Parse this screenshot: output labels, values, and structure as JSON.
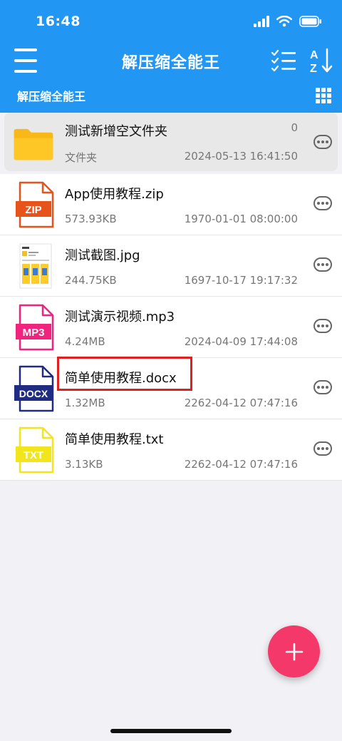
{
  "status_bar": {
    "time": "16:48"
  },
  "header": {
    "title": "解压缩全能王",
    "breadcrumb": "解压缩全能王"
  },
  "files": [
    {
      "name": "测试新增空文件夹",
      "meta": "文件夹",
      "date": "2024-05-13 16:41:50",
      "count": "0",
      "type": "folder"
    },
    {
      "name": "App使用教程.zip",
      "meta": "573.93KB",
      "date": "1970-01-01 08:00:00",
      "type": "zip",
      "badge": "ZIP",
      "color": "#e8531c"
    },
    {
      "name": "测试截图.jpg",
      "meta": "244.75KB",
      "date": "1697-10-17 19:17:32",
      "type": "image"
    },
    {
      "name": "测试演示视频.mp3",
      "meta": "4.24MB",
      "date": "2024-04-09 17:44:08",
      "type": "mp3",
      "badge": "MP3",
      "color": "#f0247e"
    },
    {
      "name": "简单使用教程.docx",
      "meta": "1.32MB",
      "date": "2262-04-12 07:47:16",
      "type": "docx",
      "badge": "DOCX",
      "color": "#1f2c82"
    },
    {
      "name": "简单使用教程.txt",
      "meta": "3.13KB",
      "date": "2262-04-12 07:47:16",
      "type": "txt",
      "badge": "TXT",
      "color": "#f3e51c"
    }
  ],
  "colors": {
    "header": "#2196f3",
    "fab": "#f5386a",
    "highlight": "#e02020"
  }
}
